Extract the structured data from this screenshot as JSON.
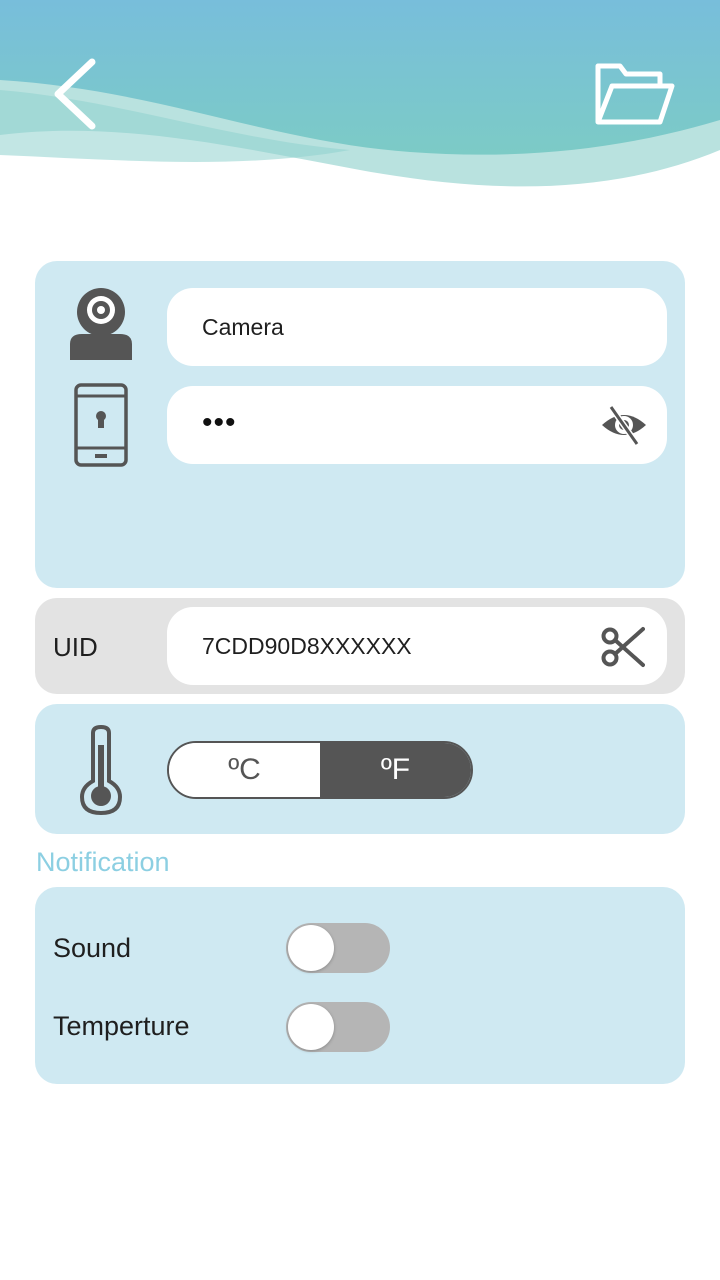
{
  "header": {
    "back_icon": "chevron-left-icon",
    "folder_icon": "folder-open-icon"
  },
  "device": {
    "name_value": "Camera",
    "password_value": "•••",
    "camera_icon": "camera-icon",
    "phone_icon": "phone-lock-icon",
    "visibility_icon": "eye-slash-icon"
  },
  "uid": {
    "label": "UID",
    "value": "7CDD90D8XXXXXX",
    "copy_icon": "scissors-icon"
  },
  "temperature": {
    "thermometer_icon": "thermometer-icon",
    "celsius_label": "ºC",
    "fahrenheit_label": "ºF",
    "selected": "ºF"
  },
  "notification": {
    "title": "Notification",
    "sound_label": "Sound",
    "sound_enabled": false,
    "temperature_label": "Temperture",
    "temperature_enabled": false
  },
  "colors": {
    "header_wave_top": "#7ac3d9",
    "header_wave_mid": "#7fcac4",
    "card_blue": "#cfe9f2",
    "card_gray": "#e3e3e3",
    "section_title": "#8ccfe2",
    "toggle_dark": "#555555",
    "switch_off": "#b5b5b5"
  }
}
